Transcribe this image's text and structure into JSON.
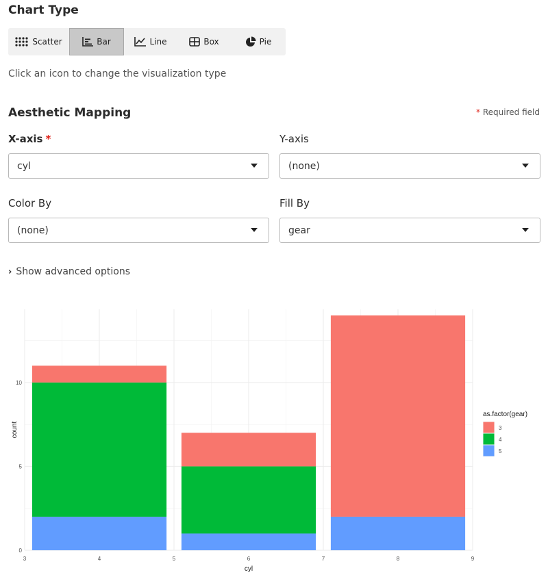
{
  "chart_type": {
    "title": "Chart Type",
    "hint": "Click an icon to change the visualization type",
    "buttons": [
      {
        "label": "Scatter",
        "icon": "scatter-icon",
        "active": false
      },
      {
        "label": "Bar",
        "icon": "bar-chart-icon",
        "active": true
      },
      {
        "label": "Line",
        "icon": "line-chart-icon",
        "active": false
      },
      {
        "label": "Box",
        "icon": "box-plot-icon",
        "active": false
      },
      {
        "label": "Pie",
        "icon": "pie-chart-icon",
        "active": false
      }
    ]
  },
  "aesthetic": {
    "title": "Aesthetic Mapping",
    "required_star": "*",
    "required_note": "Required field",
    "x_axis": {
      "label": "X-axis",
      "value": "cyl",
      "required": true
    },
    "y_axis": {
      "label": "Y-axis",
      "value": "(none)"
    },
    "color_by": {
      "label": "Color By",
      "value": "(none)"
    },
    "fill_by": {
      "label": "Fill By",
      "value": "gear"
    }
  },
  "advanced": {
    "label": "Show advanced options"
  },
  "colors": {
    "required_star": "#e0241b",
    "active_button": "#c8c8c8"
  },
  "chart_data": {
    "type": "bar",
    "stacked": true,
    "xlabel": "cyl",
    "ylabel": "count",
    "xlim": [
      3,
      9
    ],
    "ylim": [
      0,
      14
    ],
    "x_ticks": [
      "3",
      "4",
      "5",
      "6",
      "7",
      "8",
      "9"
    ],
    "y_ticks": [
      "0",
      "5",
      "10"
    ],
    "categories": [
      4,
      6,
      8
    ],
    "bar_width": 1.8,
    "legend_title": "as.factor(gear)",
    "legend_position": "right",
    "grid": true,
    "series": [
      {
        "name": "3",
        "color": "#F8766D",
        "values": [
          1,
          2,
          12
        ]
      },
      {
        "name": "4",
        "color": "#00BA38",
        "values": [
          8,
          4,
          0
        ]
      },
      {
        "name": "5",
        "color": "#619CFF",
        "values": [
          2,
          1,
          2
        ]
      }
    ]
  }
}
